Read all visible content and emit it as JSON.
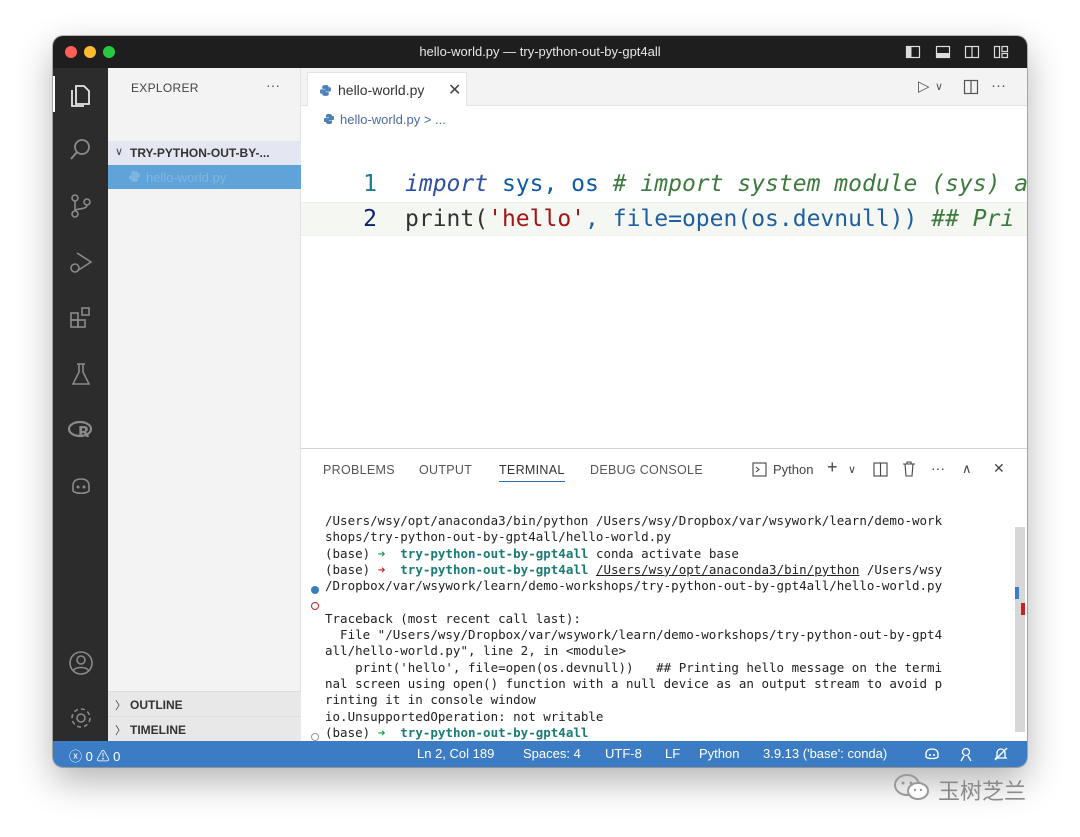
{
  "window": {
    "title": "hello-world.py — try-python-out-by-gpt4all"
  },
  "sidebar": {
    "title": "EXPLORER",
    "more": "···",
    "folder": "TRY-PYTHON-OUT-BY-...",
    "file": "hello-world.py",
    "sections": [
      "OUTLINE",
      "TIMELINE"
    ]
  },
  "editor": {
    "tab_label": "hello-world.py",
    "tab_close": "✕",
    "breadcrumb": "hello-world.py > ...",
    "lines": [
      {
        "number": "1",
        "text": "import sys, os  # import system module (sys) a"
      },
      {
        "number": "2",
        "text": "print('hello', file=open(os.devnull))   ## Pri"
      }
    ]
  },
  "panel": {
    "tabs": [
      "PROBLEMS",
      "OUTPUT",
      "TERMINAL",
      "DEBUG CONSOLE"
    ],
    "active_tab": "TERMINAL",
    "terminal_profile": "Python",
    "terminal_lines": [
      "/Users/wsy/opt/anaconda3/bin/python /Users/wsy/Dropbox/var/wsywork/learn/demo-work",
      "shops/try-python-out-by-gpt4all/hello-world.py",
      "(base) ➜  try-python-out-by-gpt4all conda activate base",
      "(base) ➜  try-python-out-by-gpt4all /Users/wsy/opt/anaconda3/bin/python /Users/wsy",
      "/Dropbox/var/wsywork/learn/demo-workshops/try-python-out-by-gpt4all/hello-world.py",
      "",
      "Traceback (most recent call last):",
      "  File \"/Users/wsy/Dropbox/var/wsywork/learn/demo-workshops/try-python-out-by-gpt4",
      "all/hello-world.py\", line 2, in <module>",
      "    print('hello', file=open(os.devnull))   ## Printing hello message on the termi",
      "nal screen using open() function with a null device as an output stream to avoid p",
      "rinting it in console window",
      "io.UnsupportedOperation: not writable",
      "(base) ➜  try-python-out-by-gpt4all"
    ]
  },
  "statusbar": {
    "errors": "0",
    "warnings": "0",
    "position": "Ln 2, Col 189",
    "spaces": "Spaces: 4",
    "encoding": "UTF-8",
    "eol": "LF",
    "language": "Python",
    "interpreter": "3.9.13 ('base': conda)"
  },
  "watermark": {
    "text": "玉树芝兰"
  },
  "colors": {
    "activity_bar": "#2c2c2c",
    "status_bar": "#3b7cc4",
    "selection": "#5fa3d9",
    "traffic_red": "#fe5f57",
    "traffic_yellow": "#febc2e",
    "traffic_green": "#28c840"
  }
}
